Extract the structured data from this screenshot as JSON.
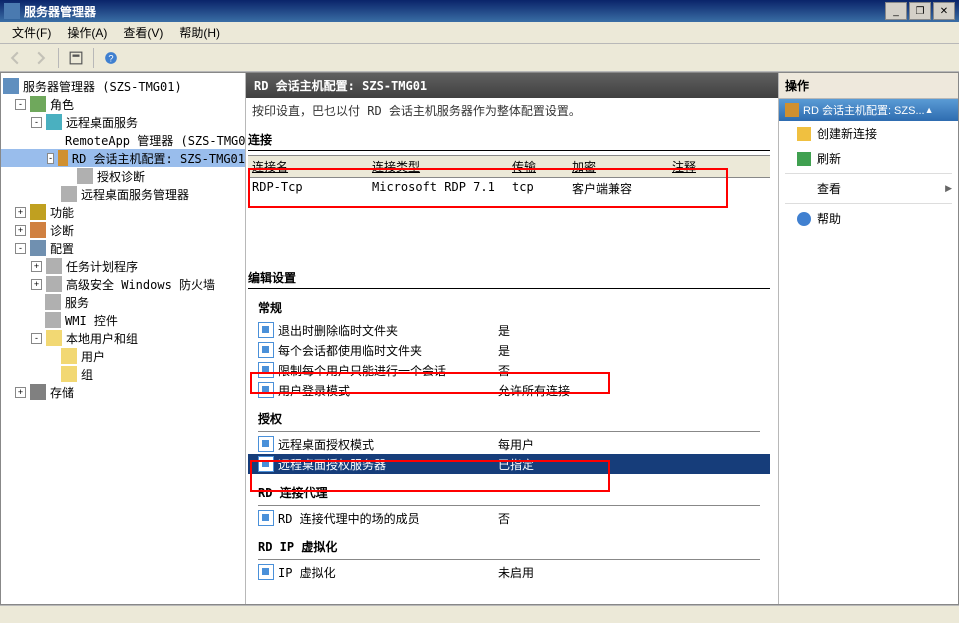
{
  "window": {
    "title": "服务器管理器",
    "min": "_",
    "restore": "❐",
    "close": "✕"
  },
  "menu": {
    "file": "文件(F)",
    "action": "操作(A)",
    "view": "查看(V)",
    "help": "帮助(H)"
  },
  "tree": {
    "root": "服务器管理器 (SZS-TMG01)",
    "roles": "角色",
    "rds": "远程桌面服务",
    "remoteapp": "RemoteApp 管理器 (SZS-TMG0",
    "rdhost": "RD 会话主机配置: SZS-TMG01",
    "licdiag": "授权诊断",
    "rdsmgr": "远程桌面服务管理器",
    "features": "功能",
    "diagnostics": "诊断",
    "config": "配置",
    "tasksched": "任务计划程序",
    "firewall": "高级安全 Windows 防火墙",
    "services": "服务",
    "wmi": "WMI 控件",
    "localusers": "本地用户和组",
    "users": "用户",
    "groups": "组",
    "storage": "存储"
  },
  "center": {
    "header_prefix": "RD 会话主机配置: ",
    "header_host": "SZS-TMG01",
    "partial_top": "按印设直，巴乜以付 RD 会话主机服务器作为整体配置设置。",
    "sec_conn": "连接",
    "col_name": "连接名",
    "col_type": "连接类型",
    "col_trans": "传输",
    "col_enc": "加密",
    "col_comment": "注释",
    "row1_name": "RDP-Tcp",
    "row1_type": "Microsoft RDP 7.1",
    "row1_trans": "tcp",
    "row1_enc": "客户端兼容",
    "sec_edit": "编辑设置",
    "sub_general": "常规",
    "g1_label": "退出时删除临时文件夹",
    "g1_value": "是",
    "g2_label": "每个会话都使用临时文件夹",
    "g2_value": "是",
    "g3_label": "限制每个用户只能进行一个会话",
    "g3_value": "否",
    "g4_label": "用户登录模式",
    "g4_value": "允许所有连接",
    "sub_lic": "授权",
    "l1_label": "远程桌面授权模式",
    "l1_value": "每用户",
    "l2_label": "远程桌面授权服务器",
    "l2_value": "已指定",
    "sub_broker": "RD 连接代理",
    "b1_label": "RD 连接代理中的场的成员",
    "b1_value": "否",
    "sub_ipvirt": "RD IP 虚拟化",
    "ip1_label": "IP 虚拟化",
    "ip1_value": "未启用"
  },
  "actions": {
    "header": "操作",
    "sub": "RD 会话主机配置: SZS...",
    "new_conn": "创建新连接",
    "refresh": "刷新",
    "view": "查看",
    "help": "帮助"
  }
}
